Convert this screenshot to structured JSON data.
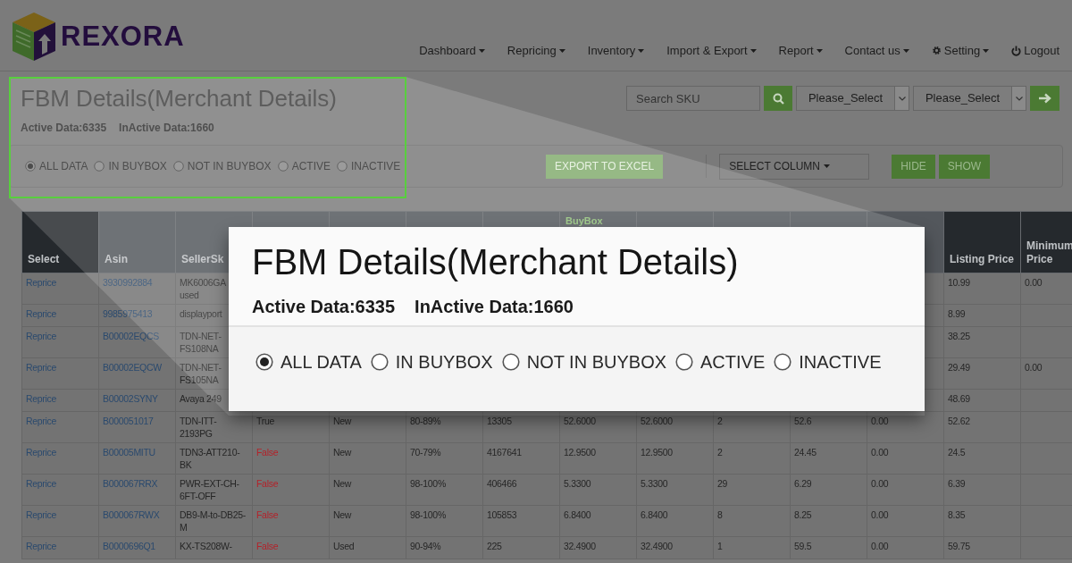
{
  "logo": {
    "text": "REXORA"
  },
  "nav": [
    {
      "label": "Dashboard",
      "kind": "plain",
      "dropdown": true
    },
    {
      "label": "Repricing",
      "kind": "plain",
      "dropdown": true
    },
    {
      "label": "Inventory",
      "kind": "plain",
      "dropdown": true
    },
    {
      "label": "Import & Export",
      "kind": "plain",
      "dropdown": true
    },
    {
      "label": "Report",
      "kind": "plain",
      "dropdown": true
    },
    {
      "label": "Contact us",
      "kind": "plain",
      "dropdown": true
    },
    {
      "label": "Setting",
      "kind": "settings",
      "dropdown": true
    },
    {
      "label": "Logout",
      "kind": "logout",
      "dropdown": false
    }
  ],
  "page": {
    "title": "FBM Details(Merchant Details)",
    "counts": [
      "Active Data:6335",
      "InActive Data:1660"
    ]
  },
  "search": {
    "placeholder": "Search SKU"
  },
  "selects": [
    {
      "value": "Please_Select"
    },
    {
      "value": "Please_Select"
    }
  ],
  "filters": [
    {
      "label": "ALL DATA",
      "selected": true
    },
    {
      "label": "IN BUYBOX",
      "selected": false
    },
    {
      "label": "NOT IN BUYBOX",
      "selected": false
    },
    {
      "label": "ACTIVE",
      "selected": false
    },
    {
      "label": "INACTIVE",
      "selected": false
    }
  ],
  "toolbar": {
    "export": "EXPORT TO EXCEL",
    "select_column": "SELECT COLUMN",
    "hide": "HIDE",
    "show": "SHOW"
  },
  "table": {
    "columns": [
      {
        "label": "Select",
        "kind": "link"
      },
      {
        "label": "Asin",
        "kind": "link"
      },
      {
        "label": "SellerSk",
        "kind": "text"
      },
      {
        "kind": "flag"
      },
      {
        "kind": "text"
      },
      {
        "kind": "text"
      },
      {
        "kind": "text"
      },
      {
        "label": "BuyBox",
        "kind": "text"
      },
      {
        "kind": "text"
      },
      {
        "kind": "text"
      },
      {
        "kind": "text"
      },
      {
        "kind": "text"
      },
      {
        "label": "Listing Price",
        "kind": "text"
      },
      {
        "label": "Minimum Price",
        "kind": "text"
      }
    ],
    "rows": [
      {
        "cells": [
          "Reprice",
          "3930992884",
          "MK6006GA\nused",
          null,
          null,
          null,
          null,
          null,
          null,
          null,
          null,
          null,
          "10.99",
          "0.00"
        ]
      },
      {
        "cells": [
          "Reprice",
          "9985975413",
          "displayport",
          null,
          null,
          null,
          null,
          null,
          null,
          null,
          null,
          null,
          "8.99",
          null
        ]
      },
      {
        "cells": [
          "Reprice",
          "B00002EQCS",
          "TDN-NET-FS108NA",
          null,
          null,
          null,
          null,
          null,
          null,
          null,
          null,
          null,
          "38.25",
          null
        ]
      },
      {
        "cells": [
          "Reprice",
          "B00002EQCW",
          "TDN-NET-FS105NA",
          null,
          null,
          null,
          null,
          null,
          null,
          null,
          null,
          null,
          "29.49",
          "0.00"
        ]
      },
      {
        "cells": [
          "Reprice",
          "B00002SYNY",
          "Avaya 249",
          null,
          null,
          null,
          null,
          null,
          null,
          null,
          null,
          null,
          "48.69",
          null
        ]
      },
      {
        "in_buybox": true,
        "cells": [
          "Reprice",
          "B000051017",
          "TDN-ITT-2193PG",
          "True",
          "New",
          "80-89%",
          "13305",
          "52.6000",
          "52.6000",
          "2",
          "52.6",
          "0.00",
          "52.62",
          null
        ]
      },
      {
        "in_buybox": false,
        "cells": [
          "Reprice",
          "B00005MITU",
          "TDN3-ATT210-BK",
          "False",
          "New",
          "70-79%",
          "4167641",
          "12.9500",
          "12.9500",
          "2",
          "24.45",
          "0.00",
          "24.5",
          null
        ]
      },
      {
        "in_buybox": false,
        "cells": [
          "Reprice",
          "B000067RRX",
          "PWR-EXT-CH-6FT-OFF",
          "False",
          "New",
          "98-100%",
          "406466",
          "5.3300",
          "5.3300",
          "29",
          "6.29",
          "0.00",
          "6.39",
          null
        ]
      },
      {
        "in_buybox": false,
        "cells": [
          "Reprice",
          "B000067RWX",
          "DB9-M-to-DB25-M",
          "False",
          "New",
          "98-100%",
          "105853",
          "6.8400",
          "6.8400",
          "8",
          "8.25",
          "0.00",
          "8.35",
          null
        ]
      },
      {
        "in_buybox": false,
        "cells": [
          "Reprice",
          "B0000696Q1",
          "KX-TS208W-",
          "False",
          "Used",
          "90-94%",
          "225",
          "32.4900",
          "32.4900",
          "1",
          "59.5",
          "0.00",
          "59.75",
          null
        ]
      }
    ]
  },
  "callout": {
    "title": "FBM Details(Merchant Details)",
    "counts": [
      "Active Data:6335",
      "InActive Data:1660"
    ],
    "filters": [
      {
        "label": "ALL DATA",
        "selected": true
      },
      {
        "label": "IN BUYBOX",
        "selected": false
      },
      {
        "label": "NOT IN BUYBOX",
        "selected": false
      },
      {
        "label": "ACTIVE",
        "selected": false
      },
      {
        "label": "INACTIVE",
        "selected": false
      }
    ]
  }
}
